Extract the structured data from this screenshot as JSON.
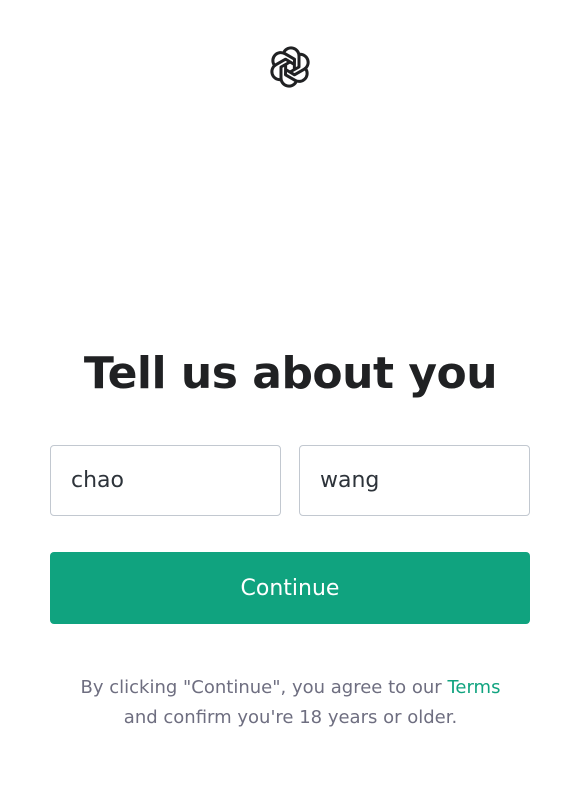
{
  "brand": {
    "logo_icon": "openai-logo-icon",
    "accent_color": "#10a37f"
  },
  "heading": {
    "title": "Tell us about you"
  },
  "form": {
    "first_name_value": "chao",
    "last_name_value": "wang",
    "continue_label": "Continue"
  },
  "legal": {
    "text_before": "By clicking \"Continue\", you agree to our ",
    "terms_link": "Terms",
    "text_after": "and confirm you're 18 years or older."
  }
}
